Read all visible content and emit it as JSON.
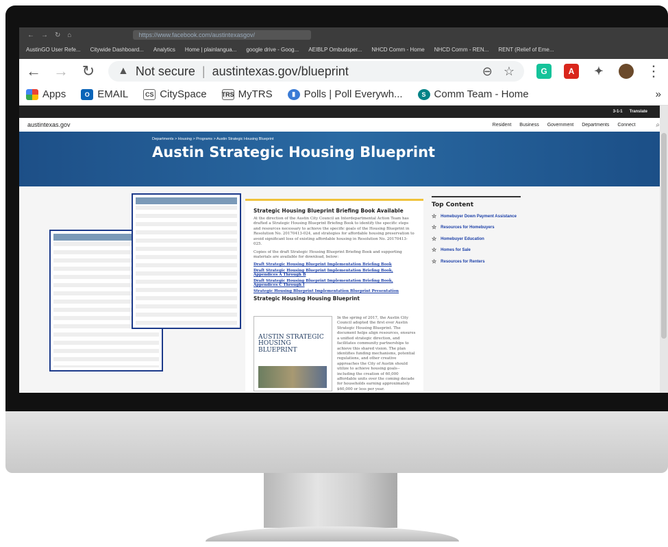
{
  "back_browser": {
    "url": "https://www.facebook.com/austintexasgov/",
    "bookmarks": [
      "AustinGO User Refe...",
      "Citywide Dashboard...",
      "Analytics",
      "Home | plainlangua...",
      "google drive - Goog...",
      "AEIBLP Ombudsper...",
      "NHCD Comm - Home",
      "NHCD Comm - REN...",
      "RENT (Relief of Eme..."
    ]
  },
  "browser": {
    "security": "Not secure",
    "url": "austintexas.gov/blueprint",
    "bookmarks": [
      {
        "label": "Apps"
      },
      {
        "label": "EMAIL"
      },
      {
        "label": "CitySpace"
      },
      {
        "label": "MyTRS"
      },
      {
        "label": "Polls | Poll Everywh..."
      },
      {
        "label": "Comm Team - Home"
      }
    ],
    "overflow": "»"
  },
  "site": {
    "topstrip": [
      "3-1-1",
      "Translate"
    ],
    "logo": "austintexas.gov",
    "nav": [
      "Resident",
      "Business",
      "Government",
      "Departments",
      "Connect"
    ],
    "breadcrumb": "Departments > Housing > Programs > Austin Strategic Housing Blueprint",
    "title": "Austin Strategic Housing Blueprint"
  },
  "article": {
    "heading1": "Strategic Housing Blueprint Briefing Book Available",
    "para1": "At the direction of the Austin City Council an Interdepartmental Action Team has drafted a Strategic Housing Blueprint Briefing Book to identify the specific steps and resources necessary to achieve the specific goals of the Housing Blueprint in Resolution No. 20170413-024, and strategies for affordable housing preservation to avoid significant loss of existing affordable housing in Resolution No. 20170413-025.",
    "para2": "Copies of the draft Strategic Housing Blueprint Briefing Book and supporting materials are available for download, below:",
    "links": [
      "Draft Strategic Housing Blueprint Implementation Briefing Book",
      "Draft Strategic Housing Blueprint Implementation Briefing Book, Appendices A Through B",
      "Draft Strategic Housing Blueprint Implementation Briefing Book, Appendices C Through I",
      "Strategic Housing Blueprint Implementation Blueprint Presentation"
    ],
    "heading2": "Strategic Housing Housing Blueprint",
    "book_title": "AUSTIN STRATEGIC HOUSING BLUEPRINT",
    "para3": "In the spring of 2017, the Austin City Council adopted the first ever Austin Strategic Housing Blueprint. The document helps align resources, ensures a unified strategic direction, and facilitates community partnerships to achieve this shared vision. The plan identifies funding mechanisms, potential regulations, and other creative approaches the City of Austin should utilize to achieve housing goals--including the creation of 60,000 affordable units over the coming decade for households earning approximately $60,000 or less per year."
  },
  "top_content": {
    "heading": "Top Content",
    "items": [
      "Homebuyer Down Payment Assistance",
      "Resources for Homebuyers",
      "Homebuyer Education",
      "Homes for Sale",
      "Resources for Renters"
    ]
  },
  "colors": {
    "banner": "#2a6aa3",
    "link": "#1a3ea7",
    "accent": "#f0c23a"
  }
}
